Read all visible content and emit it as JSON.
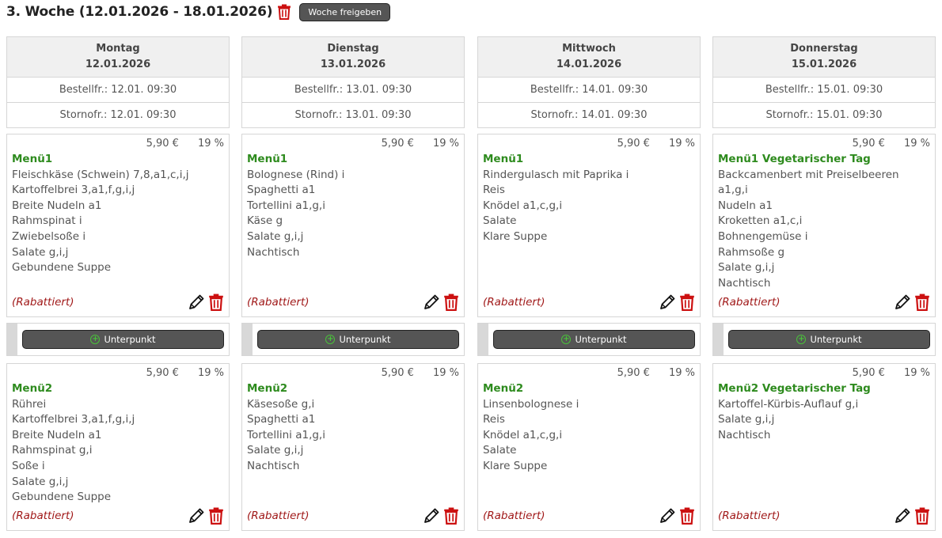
{
  "week": {
    "title": "3. Woche (12.01.2026 - 18.01.2026)",
    "release_button": "Woche freigeben"
  },
  "icons": {
    "delete": "trash-icon",
    "edit": "pencil-icon",
    "add": "plus-circle-icon"
  },
  "colors": {
    "menu_name": "#2e8b1e",
    "discount": "#a01818",
    "delete": "#cc1111",
    "button": "#555555",
    "add_icon": "#49c23a"
  },
  "days": [
    {
      "name": "Montag",
      "date": "12.01.2026",
      "order_deadline": "Bestellfr.: 12.01. 09:30",
      "cancel_deadline": "Stornofr.: 12.01. 09:30",
      "sub_button": "Unterpunkt",
      "menus": [
        {
          "price": "5,90 €",
          "tax": "19 %",
          "name": "Menü1",
          "discount": "(Rabattiert)",
          "items": [
            "Fleischkäse (Schwein) 7,8,a1,c,i,j",
            "Kartoffelbrei 3,a1,f,g,i,j",
            "Breite Nudeln a1",
            "Rahmspinat i",
            "Zwiebelsoße i",
            "Salate g,i,j",
            "Gebundene Suppe"
          ]
        },
        {
          "price": "5,90 €",
          "tax": "19 %",
          "name": "Menü2",
          "discount": "(Rabattiert)",
          "items": [
            "Rührei",
            "Kartoffelbrei 3,a1,f,g,i,j",
            "Breite Nudeln a1",
            "Rahmspinat g,i",
            "Soße i",
            "Salate g,i,j",
            "Gebundene Suppe"
          ]
        }
      ]
    },
    {
      "name": "Dienstag",
      "date": "13.01.2026",
      "order_deadline": "Bestellfr.: 13.01. 09:30",
      "cancel_deadline": "Stornofr.: 13.01. 09:30",
      "sub_button": "Unterpunkt",
      "menus": [
        {
          "price": "5,90 €",
          "tax": "19 %",
          "name": "Menü1",
          "discount": "(Rabattiert)",
          "items": [
            "Bolognese (Rind) i",
            "Spaghetti a1",
            "Tortellini a1,g,i",
            "Käse g",
            "Salate g,i,j",
            "Nachtisch"
          ]
        },
        {
          "price": "5,90 €",
          "tax": "19 %",
          "name": "Menü2",
          "discount": "(Rabattiert)",
          "items": [
            "Käsesoße g,i",
            "Spaghetti a1",
            "Tortellini a1,g,i",
            "Salate g,i,j",
            "Nachtisch"
          ]
        }
      ]
    },
    {
      "name": "Mittwoch",
      "date": "14.01.2026",
      "order_deadline": "Bestellfr.: 14.01. 09:30",
      "cancel_deadline": "Stornofr.: 14.01. 09:30",
      "sub_button": "Unterpunkt",
      "menus": [
        {
          "price": "5,90 €",
          "tax": "19 %",
          "name": "Menü1",
          "discount": "(Rabattiert)",
          "items": [
            "Rindergulasch mit Paprika i",
            "Reis",
            "Knödel a1,c,g,i",
            "Salate",
            "Klare Suppe"
          ]
        },
        {
          "price": "5,90 €",
          "tax": "19 %",
          "name": "Menü2",
          "discount": "(Rabattiert)",
          "items": [
            "Linsenbolognese i",
            "Reis",
            "Knödel a1,c,g,i",
            "Salate",
            "Klare Suppe"
          ]
        }
      ]
    },
    {
      "name": "Donnerstag",
      "date": "15.01.2026",
      "order_deadline": "Bestellfr.: 15.01. 09:30",
      "cancel_deadline": "Stornofr.: 15.01. 09:30",
      "sub_button": "Unterpunkt",
      "menus": [
        {
          "price": "5,90 €",
          "tax": "19 %",
          "name": "Menü1 Vegetarischer Tag",
          "discount": "(Rabattiert)",
          "items": [
            "Backcamenbert mit Preiselbeeren a1,g,i",
            "Nudeln a1",
            "Kroketten a1,c,i",
            "Bohnengemüse i",
            "Rahmsoße g",
            "Salate g,i,j",
            "Nachtisch"
          ]
        },
        {
          "price": "5,90 €",
          "tax": "19 %",
          "name": "Menü2 Vegetarischer Tag",
          "discount": "(Rabattiert)",
          "items": [
            "Kartoffel-Kürbis-Auflauf g,i",
            "Salate g,i,j",
            "Nachtisch"
          ]
        }
      ]
    }
  ]
}
